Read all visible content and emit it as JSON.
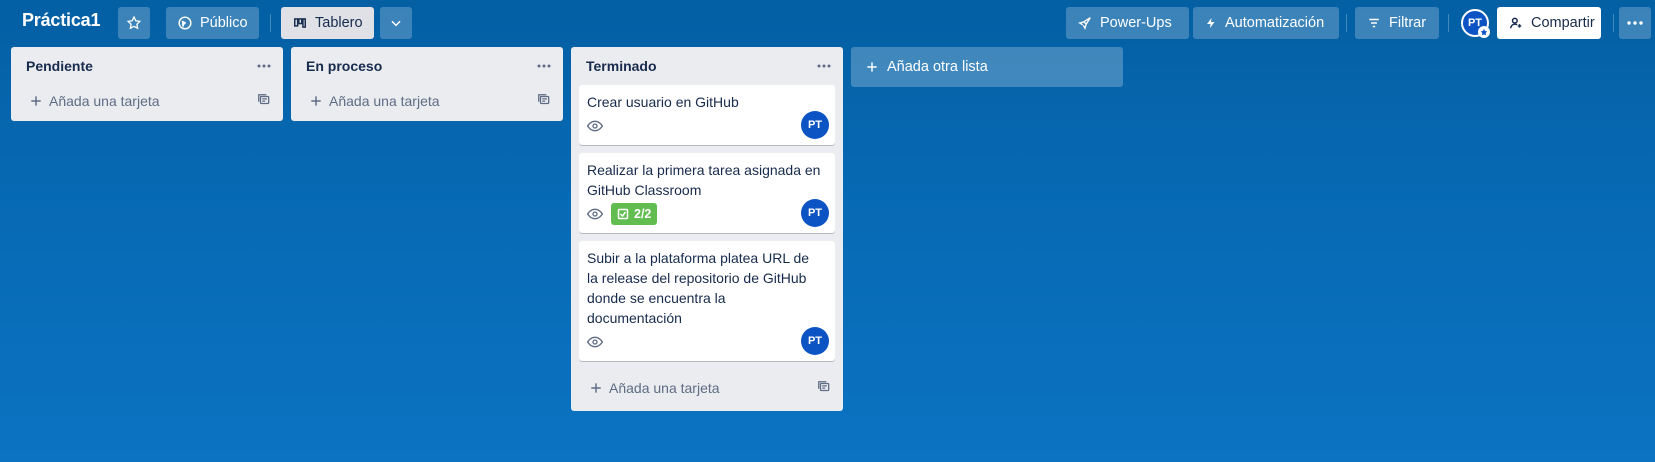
{
  "header": {
    "board_title": "Práctica1",
    "star_icon": "star-icon",
    "visibility_label": "Público",
    "view_label": "Tablero",
    "powerups_label": "Power-Ups",
    "automation_label": "Automatización",
    "filter_label": "Filtrar",
    "member_initials": "PT",
    "share_label": "Compartir"
  },
  "lists": [
    {
      "title": "Pendiente",
      "add_card_label": "Añada una tarjeta",
      "cards": []
    },
    {
      "title": "En proceso",
      "add_card_label": "Añada una tarjeta",
      "cards": []
    },
    {
      "title": "Terminado",
      "add_card_label": "Añada una tarjeta",
      "cards": [
        {
          "title": "Crear usuario en GitHub",
          "member": "PT",
          "checklist": null
        },
        {
          "title": "Realizar la primera tarea asignada en GitHub Classroom",
          "member": "PT",
          "checklist": "2/2"
        },
        {
          "title": "Subir a la plataforma platea URL de la release del repositorio de GitHub donde se encuentra la documentación",
          "member": "PT",
          "checklist": null
        }
      ]
    }
  ],
  "add_list_label": "Añada otra lista",
  "colors": {
    "board_background": "#0769b3",
    "checklist_complete": "#61bd4f",
    "avatar": "#0c54c4",
    "list_background": "#ebecf0"
  }
}
